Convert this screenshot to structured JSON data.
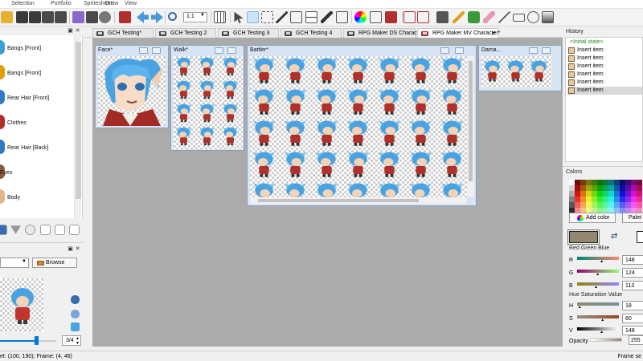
{
  "menu": [
    "Selection",
    "Portfolio",
    "Spritesheet",
    "Draw",
    "View"
  ],
  "toolbar": {
    "zoom_value": "1:1"
  },
  "layers": {
    "items": [
      {
        "label": "Bangs [Front]",
        "color": "#3c9fd6"
      },
      {
        "label": "Bangs [Front]",
        "color": "#e0a000"
      },
      {
        "label": "Rear Hair [Front]",
        "color": "#2f7ac4"
      },
      {
        "label": "Clothes",
        "color": "#b0302a"
      },
      {
        "label": "Rear Hair [Back]",
        "color": "#2f7ac4"
      },
      {
        "label": "Eyes",
        "color": "#8a5a3a"
      },
      {
        "label": "Body",
        "color": "#e2b58a"
      }
    ]
  },
  "preview": {
    "browse_label": "Browse",
    "frame_value": "3/4"
  },
  "tabs": [
    {
      "label": "GCH Testing*",
      "active": false
    },
    {
      "label": "GCH Testing 2",
      "active": false
    },
    {
      "label": "GCH Testing 3",
      "active": false
    },
    {
      "label": "GCH Testing 4",
      "active": false
    },
    {
      "label": "RPG Maker DS Character",
      "active": false
    },
    {
      "label": "RPG Maker MV Character*",
      "active": true
    }
  ],
  "subwindows": {
    "face": {
      "title": "Face*"
    },
    "walk": {
      "title": "Walk*"
    },
    "battler": {
      "title": "Battler*"
    },
    "damage": {
      "title": "Dama..."
    }
  },
  "history": {
    "title": "History",
    "items": [
      {
        "label": "<Initial state>",
        "type": "initial"
      },
      {
        "label": "Insert item",
        "type": "item"
      },
      {
        "label": "Insert item",
        "type": "item"
      },
      {
        "label": "Insert item",
        "type": "item"
      },
      {
        "label": "Insert item",
        "type": "item"
      },
      {
        "label": "Insert item",
        "type": "item"
      },
      {
        "label": "Insert item",
        "type": "item",
        "selected": true
      }
    ]
  },
  "colors": {
    "title": "Colors",
    "add_color_label": "Add color",
    "palette_button_label": "Palet",
    "current_color": "#948771",
    "rgb_label": "Red Green Blue",
    "rgb": [
      {
        "label": "R",
        "value": "148",
        "gradient": [
          "#008771",
          "#ff8771"
        ]
      },
      {
        "label": "G",
        "value": "124",
        "gradient": [
          "#940071",
          "#94ff71"
        ]
      },
      {
        "label": "B",
        "value": "113",
        "gradient": [
          "#948700",
          "#9487ff"
        ]
      }
    ],
    "hsv_label": "Hue Saturation Value",
    "hsv": [
      {
        "label": "H",
        "value": "18",
        "gradient": [
          "#948771",
          "#7194a0"
        ]
      },
      {
        "label": "S",
        "value": "60",
        "gradient": [
          "#948f8a",
          "#944a1e"
        ]
      },
      {
        "label": "V",
        "value": "148",
        "gradient": [
          "#000000",
          "#ffffff"
        ]
      }
    ],
    "opacity_label": "Opacity",
    "opacity_value": "255"
  },
  "status": {
    "left": "et: (100, 190); Frame: (4, 46)",
    "right": "Frame se"
  }
}
